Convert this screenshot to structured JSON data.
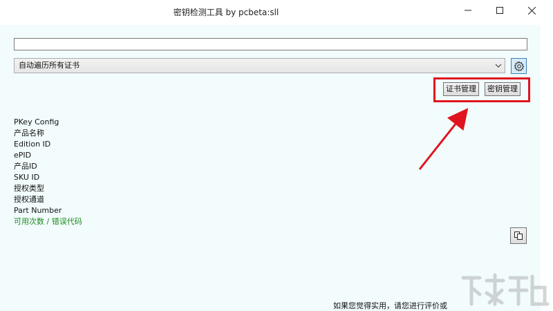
{
  "window": {
    "title": "密钥检测工具 by pcbeta:sll",
    "controls": [
      "minimize",
      "maximize",
      "close"
    ]
  },
  "input": {
    "value": "",
    "placeholder": ""
  },
  "select": {
    "value": "自动遍历所有证书",
    "options": [
      "自动遍历所有证书"
    ]
  },
  "buttons": {
    "cert_manage": "证书管理",
    "key_manage": "密钥管理"
  },
  "info_fields": [
    "PKey Config",
    "产品名称",
    "Edition ID",
    "ePID",
    "产品ID",
    "SKU ID",
    "授权类型",
    "授权通道",
    "Part Number",
    "可用次数 / 错误代码"
  ],
  "footer": {
    "text": "如果您觉得实用，请您进行评价或"
  },
  "colors": {
    "client_background": "#f2fcfd",
    "annotation_red": "#e0141e",
    "status_green": "#1e8a1e",
    "gear_button_bg": "#d6ebf7"
  },
  "icons": {
    "settings": "gear-icon",
    "copy": "copy-icon",
    "dropdown": "chevron-down-icon"
  }
}
